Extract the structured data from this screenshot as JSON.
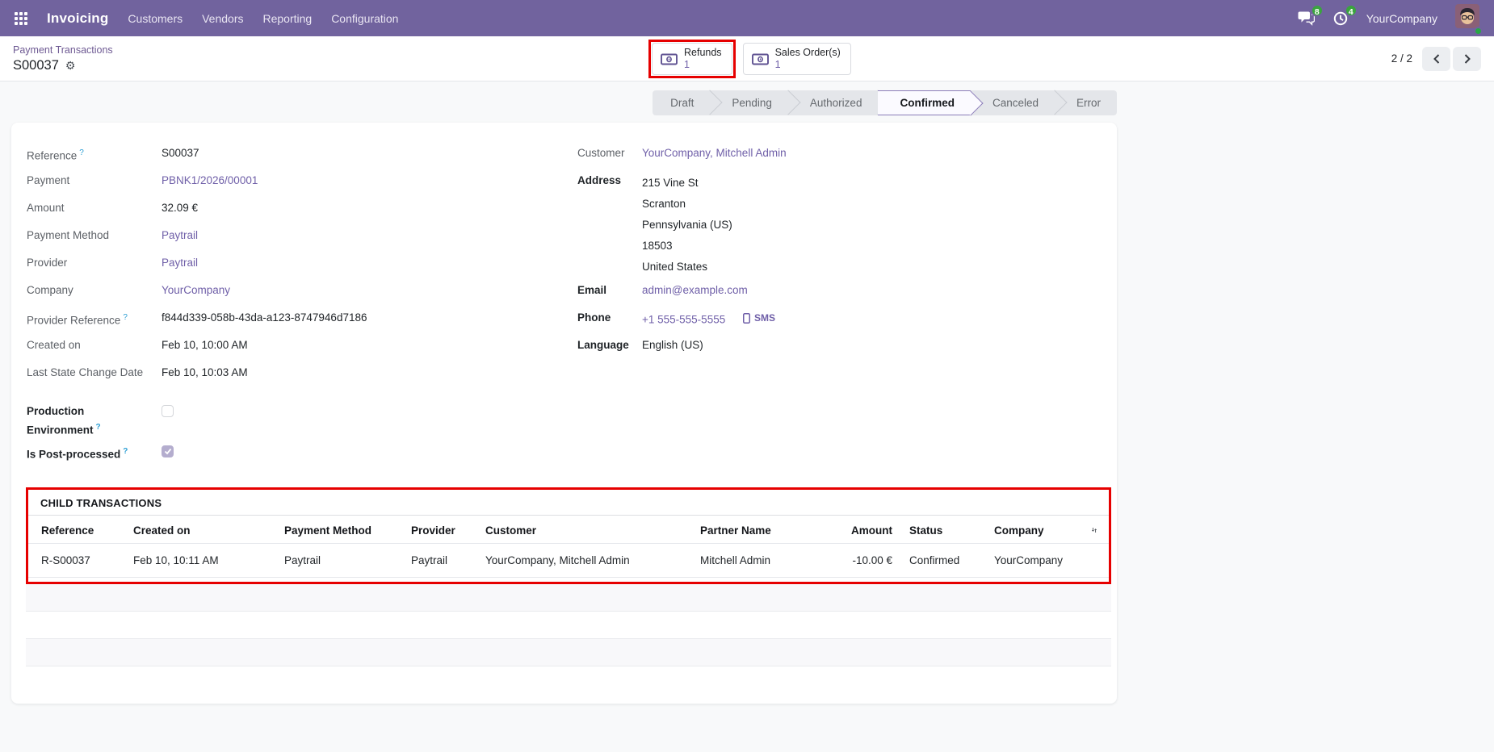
{
  "colors": {
    "navbar": "#71639e",
    "link": "#6f5fa8",
    "highlight": "#e60000",
    "badge_green": "#3aa43e",
    "active_step_bg": "#fbfaff"
  },
  "icons": {
    "gear": "⚙"
  },
  "nav": {
    "app_name": "Invoicing",
    "menus": [
      "Customers",
      "Vendors",
      "Reporting",
      "Configuration"
    ],
    "messages_count": "8",
    "activities_count": "4",
    "company": "YourCompany"
  },
  "breadcrumb": {
    "parent": "Payment Transactions",
    "current": "S00037"
  },
  "stat_buttons": [
    {
      "label": "Refunds",
      "value": "1",
      "highlighted": true
    },
    {
      "label": "Sales Order(s)",
      "value": "1",
      "highlighted": false
    }
  ],
  "pager": {
    "text": "2 / 2"
  },
  "statusbar": {
    "steps": [
      "Draft",
      "Pending",
      "Authorized",
      "Confirmed",
      "Canceled",
      "Error"
    ],
    "active": "Confirmed"
  },
  "form": {
    "help_marker": "?",
    "left": [
      {
        "label": "Reference",
        "value": "S00037"
      },
      {
        "label": "Payment",
        "value": "PBNK1/2026/00001"
      },
      {
        "label": "Amount",
        "value": "32.09 €"
      },
      {
        "label": "Payment Method",
        "value": "Paytrail"
      },
      {
        "label": "Provider",
        "value": "Paytrail"
      },
      {
        "label": "Company",
        "value": "YourCompany"
      },
      {
        "label": "Provider Reference",
        "value": "f844d339-058b-43da-a123-8747946d7186"
      },
      {
        "label": "Created on",
        "value": "Feb 10, 10:00 AM"
      },
      {
        "label": "Last State Change Date",
        "value": "Feb 10, 10:03 AM"
      },
      {
        "label": "Production Environment",
        "checked": false
      },
      {
        "label": "Is Post-processed",
        "checked": true
      }
    ],
    "right": {
      "customer_label": "Customer",
      "customer": "YourCompany, Mitchell Admin",
      "address_label": "Address",
      "address_lines": [
        "215 Vine St",
        "Scranton",
        "Pennsylvania (US)",
        "18503",
        "United States"
      ],
      "email_label": "Email",
      "email": "admin@example.com",
      "phone_label": "Phone",
      "phone": "+1 555-555-5555",
      "sms": "SMS",
      "language_label": "Language",
      "language": "English (US)"
    }
  },
  "child_transactions": {
    "title": "CHILD TRANSACTIONS",
    "columns": [
      "Reference",
      "Created on",
      "Payment Method",
      "Provider",
      "Customer",
      "Partner Name",
      "Amount",
      "Status",
      "Company"
    ],
    "rows": [
      [
        "R-S00037",
        "Feb 10, 10:11 AM",
        "Paytrail",
        "Paytrail",
        "YourCompany, Mitchell Admin",
        "Mitchell Admin",
        "-10.00 €",
        "Confirmed",
        "YourCompany"
      ]
    ]
  }
}
